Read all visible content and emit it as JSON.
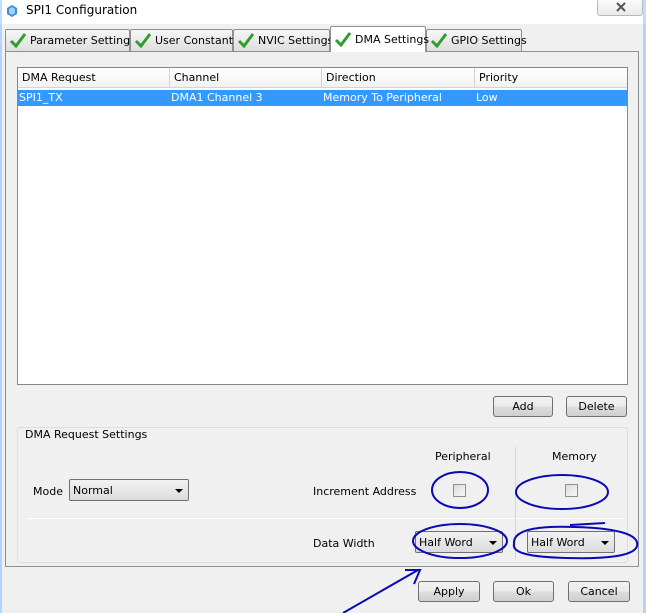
{
  "window": {
    "title": "SPI1 Configuration"
  },
  "tabs": [
    {
      "label": "Parameter Settings",
      "active": false
    },
    {
      "label": "User Constants",
      "active": false
    },
    {
      "label": "NVIC Settings",
      "active": false
    },
    {
      "label": "DMA Settings",
      "active": true
    },
    {
      "label": "GPIO Settings",
      "active": false
    }
  ],
  "table": {
    "columns": [
      "DMA Request",
      "Channel",
      "Direction",
      "Priority"
    ],
    "rows": [
      {
        "request": "SPI1_TX",
        "channel": "DMA1 Channel 3",
        "direction": "Memory To Peripheral",
        "priority": "Low",
        "selected": true
      }
    ]
  },
  "table_buttons": {
    "add": "Add",
    "delete": "Delete"
  },
  "request_settings": {
    "legend": "DMA Request Settings",
    "mode_label": "Mode",
    "mode_value": "Normal",
    "peripheral_header": "Peripheral",
    "memory_header": "Memory",
    "increment_label": "Increment Address",
    "peripheral_increment": false,
    "memory_increment": false,
    "data_width_label": "Data Width",
    "peripheral_width": "Half Word",
    "memory_width": "Half Word"
  },
  "footer": {
    "apply": "Apply",
    "ok": "Ok",
    "cancel": "Cancel"
  },
  "colors": {
    "selection": "#3399ff",
    "annotation": "#0a0ab4",
    "check": "#2e9e2e"
  }
}
